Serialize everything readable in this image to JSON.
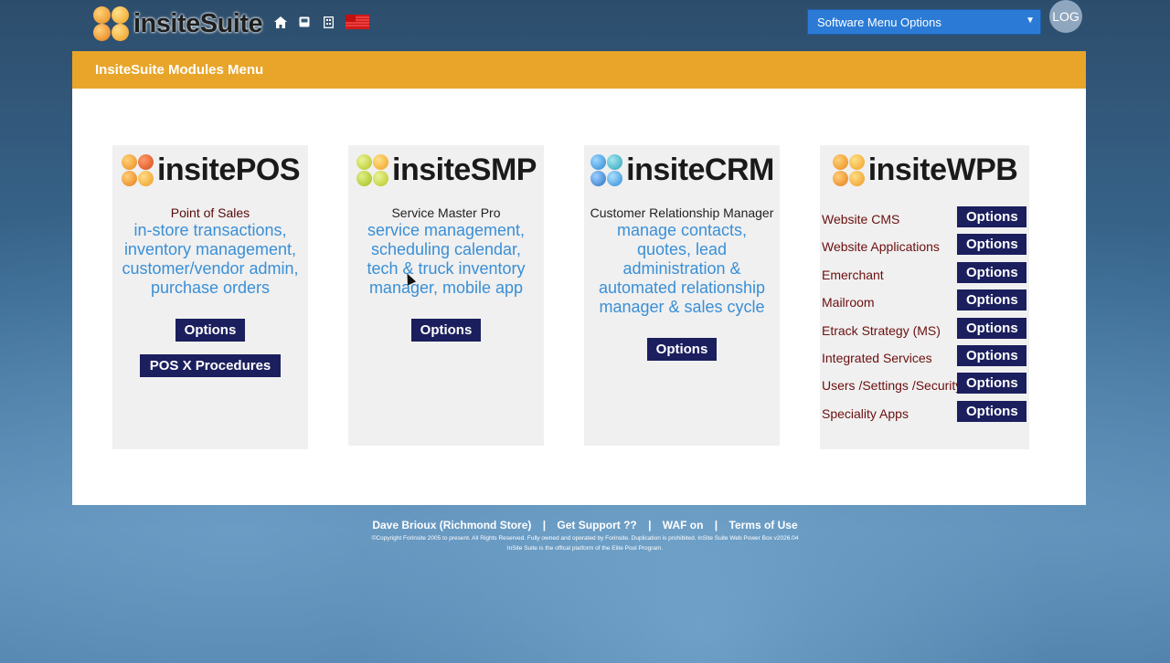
{
  "header": {
    "logo_text": "insiteSuite",
    "nav_icons": [
      "home-icon",
      "inbox-icon",
      "building-icon",
      "flag-icon"
    ],
    "menu_select": {
      "selected": "Software Menu Options"
    },
    "log_button": "LOG"
  },
  "panel": {
    "title": "InsiteSuite Modules Menu",
    "cards": [
      {
        "name": "insitePOS",
        "subtitle": "Point of Sales",
        "description": "in-store transactions, inventory management, customer/vendor admin, purchase orders",
        "options_label": "Options",
        "extra_button": "POS X Procedures"
      },
      {
        "name": "insiteSMP",
        "subtitle": "Service Master Pro",
        "description": "service management, scheduling calendar, tech & truck inventory manager, mobile app",
        "options_label": "Options"
      },
      {
        "name": "insiteCRM",
        "subtitle": "Customer Relationship Manager",
        "description": "manage contacts, quotes, lead administration & automated relationship manager & sales cycle",
        "options_label": "Options"
      },
      {
        "name": "insiteWPB",
        "items": [
          {
            "label": "Website CMS",
            "button": "Options"
          },
          {
            "label": "Website Applications",
            "button": "Options"
          },
          {
            "label": "Emerchant",
            "button": "Options"
          },
          {
            "label": "Mailroom",
            "button": "Options"
          },
          {
            "label": "Etrack Strategy (MS)",
            "button": "Options"
          },
          {
            "label": "Integrated Services",
            "button": "Options"
          },
          {
            "label": "Users /Settings /Security",
            "button": "Options"
          },
          {
            "label": "Speciality Apps",
            "button": "Options"
          }
        ]
      }
    ]
  },
  "footer": {
    "user": "Dave Brioux (Richmond Store)",
    "support": "Get Support ??",
    "waf": "WAF on",
    "terms": "Terms of Use",
    "separator": "|",
    "copyright": "©Copyright Forinsite 2005 to present. All Rights Reserved. Fully owned and operated by Forinsite. Duplication is prohibited. InSite Suite Web Power Box v2026.04",
    "tagline": "InSite Suite is the offical platform of the Elite Pool Program."
  },
  "colors": {
    "panel_header": "#e8a52a",
    "button": "#1b1f5e",
    "description_text": "#3a8fd6",
    "subtitle_text": "#5a0a0a",
    "select_bg": "#2b7bd6"
  }
}
